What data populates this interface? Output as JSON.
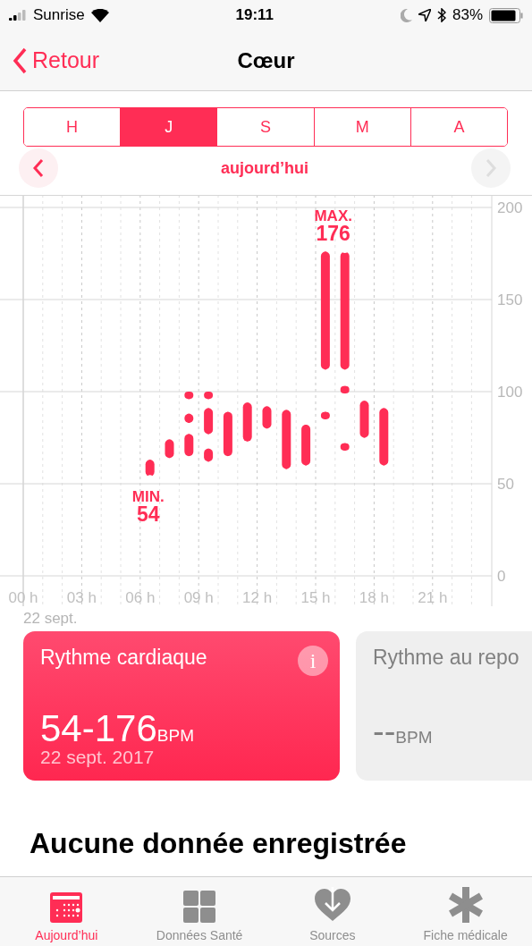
{
  "status_bar": {
    "carrier": "Sunrise",
    "time": "19:11",
    "battery": "83%"
  },
  "nav": {
    "back": "Retour",
    "title": "Cœur"
  },
  "segments": [
    {
      "label": "H",
      "selected": false
    },
    {
      "label": "J",
      "selected": true
    },
    {
      "label": "S",
      "selected": false
    },
    {
      "label": "M",
      "selected": false
    },
    {
      "label": "A",
      "selected": false
    }
  ],
  "period": {
    "label": "aujourd’hui",
    "prev_disabled": false,
    "next_disabled": true
  },
  "chart": {
    "chart_data": {
      "type": "candlestick",
      "grid": true,
      "xlim": [
        0,
        24
      ],
      "ylim": [
        0,
        200
      ],
      "yticks": [
        0,
        50,
        100,
        150,
        200
      ],
      "xticks": [
        {
          "value": 0,
          "label": "00 h"
        },
        {
          "value": 3,
          "label": "03 h"
        },
        {
          "value": 6,
          "label": "06 h"
        },
        {
          "value": 9,
          "label": "09 h"
        },
        {
          "value": 12,
          "label": "12 h"
        },
        {
          "value": 15,
          "label": "15 h"
        },
        {
          "value": 18,
          "label": "18 h"
        },
        {
          "value": 21,
          "label": "21 h"
        }
      ],
      "series": [
        {
          "color": "#ff2d55",
          "x": [
            6.5,
            7.5,
            8.5,
            9.5,
            10.5,
            11.5,
            12.5,
            13.5,
            14.5,
            15.5,
            16.5,
            17.5,
            18.5
          ],
          "ohlc": [
            [
              54,
              63,
              54,
              63
            ],
            [
              64,
              74,
              64,
              74
            ],
            [
              65,
              77,
              65,
              77
            ],
            [
              62,
              69,
              62,
              69
            ],
            [
              65,
              89,
              65,
              89
            ],
            [
              73,
              94,
              73,
              94
            ],
            [
              80,
              92,
              80,
              92
            ],
            [
              58,
              90,
              58,
              90
            ],
            [
              60,
              82,
              60,
              82
            ],
            [
              112,
              176,
              112,
              176
            ],
            [
              112,
              176,
              112,
              176
            ],
            [
              75,
              95,
              75,
              95
            ],
            [
              60,
              91,
              60,
              91
            ]
          ]
        },
        {
          "color": "#ff2d55",
          "x": [
            8.5,
            9.5,
            15.5,
            16.5
          ],
          "ohlc": [
            [
              83,
              88,
              83,
              88
            ],
            [
              77,
              91,
              77,
              91
            ],
            [
              85,
              89,
              85,
              89
            ],
            [
              99,
              103,
              99,
              103
            ]
          ]
        },
        {
          "color": "#ff2d55",
          "x": [
            8.5,
            9.5,
            16.5
          ],
          "ohlc": [
            [
              96,
              100,
              96,
              100
            ],
            [
              96,
              100,
              96,
              100
            ],
            [
              68,
              72,
              68,
              72
            ]
          ]
        }
      ],
      "annotations": [
        "MIN.",
        "54",
        "MAX.",
        "176"
      ]
    },
    "date": "22 sept."
  },
  "cards": [
    {
      "kind": "active",
      "title": "Rythme cardiaque",
      "value": "54-176",
      "unit": "BPM",
      "date": "22 sept. 2017",
      "info": "i"
    },
    {
      "kind": "empty",
      "title": "Rythme au repo",
      "value": "--",
      "unit": "BPM"
    }
  ],
  "heading": "Aucune donnée enregistrée",
  "tab_bar": [
    {
      "label": "Aujourd’hui",
      "selected": true
    },
    {
      "label": "Données Santé",
      "selected": false
    },
    {
      "label": "Sources",
      "selected": false
    },
    {
      "label": "Fiche médicale",
      "selected": false
    }
  ]
}
